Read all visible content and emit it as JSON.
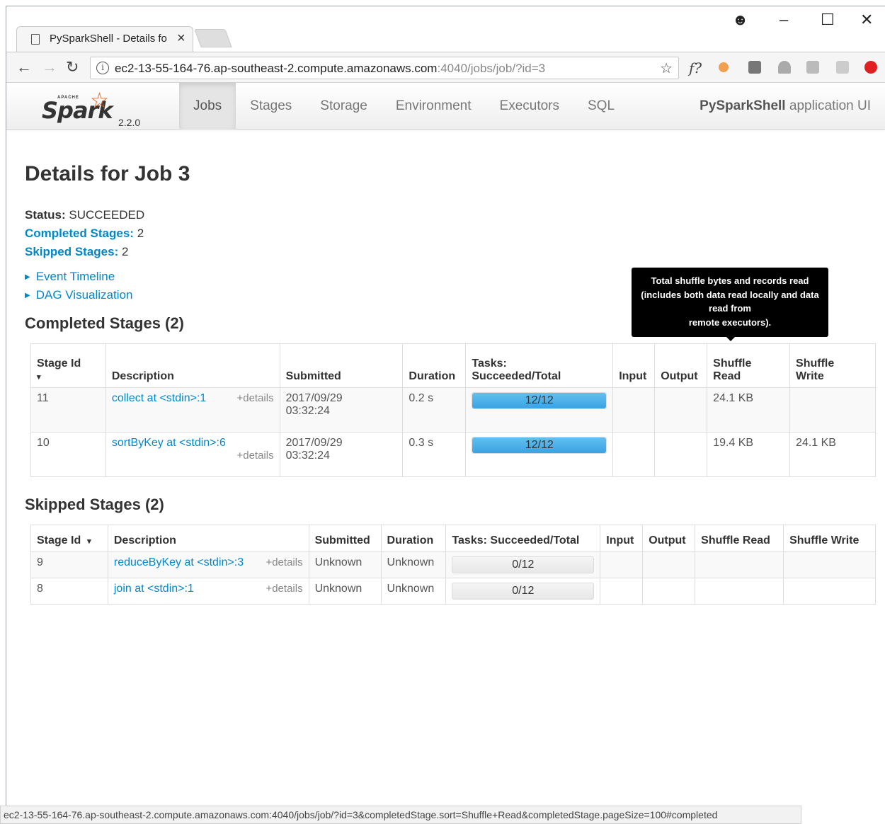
{
  "browser": {
    "tab_title": "PySparkShell - Details fo",
    "url_host": "ec2-13-55-164-76.ap-southeast-2.compute.amazonaws.com",
    "url_rest": ":4040/jobs/job/?id=3",
    "status_url": "ec2-13-55-164-76.ap-southeast-2.compute.amazonaws.com:4040/jobs/job/?id=3&completedStage.sort=Shuffle+Read&completedStage.pageSize=100#completed"
  },
  "navbar": {
    "brand_apache": "APACHE",
    "brand_name": "Spark",
    "version": "2.2.0",
    "links": [
      "Jobs",
      "Stages",
      "Storage",
      "Environment",
      "Executors",
      "SQL"
    ],
    "app_bold": "PySparkShell",
    "app_suffix": " application UI"
  },
  "page": {
    "title": "Details for Job 3",
    "status_label": "Status:",
    "status_value": "SUCCEEDED",
    "completed_label": "Completed Stages:",
    "completed_value": "2",
    "skipped_label": "Skipped Stages:",
    "skipped_value": "2",
    "event_timeline": "Event Timeline",
    "dag_visualization": "DAG Visualization"
  },
  "completed": {
    "heading": "Completed Stages (2)",
    "headers": {
      "stage_id": "Stage Id",
      "sort_arrow": "▾",
      "description": "Description",
      "submitted": "Submitted",
      "duration": "Duration",
      "tasks_line1": "Tasks:",
      "tasks_line2": "Succeeded/Total",
      "input": "Input",
      "output": "Output",
      "shuffle_read_1": "Shuffle",
      "shuffle_read_2": "Read",
      "shuffle_write_1": "Shuffle",
      "shuffle_write_2": "Write"
    },
    "rows": [
      {
        "id": "11",
        "desc": "collect at <stdin>:1",
        "details": "+details",
        "date": "2017/09/29",
        "time": "03:32:24",
        "duration": "0.2 s",
        "tasks": "12/12",
        "fraction": 1.0,
        "input": "",
        "output": "",
        "shuffle_read": "24.1 KB",
        "shuffle_write": ""
      },
      {
        "id": "10",
        "desc": "sortByKey at <stdin>:6",
        "details": "+details",
        "date": "2017/09/29",
        "time": "03:32:24",
        "duration": "0.3 s",
        "tasks": "12/12",
        "fraction": 1.0,
        "input": "",
        "output": "",
        "shuffle_read": "19.4 KB",
        "shuffle_write": "24.1 KB"
      }
    ]
  },
  "tooltip": {
    "line1": "Total shuffle bytes and records read",
    "line2": "(includes both data read locally and data",
    "line3": "read from",
    "line4": "remote executors)."
  },
  "skipped": {
    "heading": "Skipped Stages (2)",
    "headers": {
      "stage_id": "Stage Id",
      "sort_arrow": "▾",
      "description": "Description",
      "submitted": "Submitted",
      "duration": "Duration",
      "tasks": "Tasks: Succeeded/Total",
      "input": "Input",
      "output": "Output",
      "shuffle_read": "Shuffle Read",
      "shuffle_write": "Shuffle Write"
    },
    "rows": [
      {
        "id": "9",
        "desc": "reduceByKey at <stdin>:3",
        "details": "+details",
        "submitted": "Unknown",
        "duration": "Unknown",
        "tasks": "0/12",
        "fraction": 0
      },
      {
        "id": "8",
        "desc": "join at <stdin>:1",
        "details": "+details",
        "submitted": "Unknown",
        "duration": "Unknown",
        "tasks": "0/12",
        "fraction": 0
      }
    ]
  },
  "colors": {
    "link": "#0088cc",
    "progress": "#3aa3e3",
    "spark_orange": "#e25a1c"
  }
}
